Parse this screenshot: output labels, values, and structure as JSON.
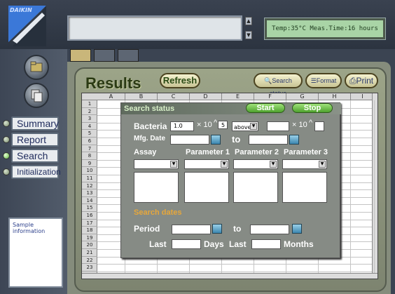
{
  "app": {
    "logo_text": "DAIKIN"
  },
  "status": {
    "lcd": "Temp:35°C  Meas.Time:16 hours"
  },
  "tabs": [
    "tab1",
    "tab2",
    "tab3"
  ],
  "nav": {
    "items": [
      "Summary",
      "Report",
      "Search",
      "Initialization"
    ],
    "selected": "Search"
  },
  "sample_panel": {
    "label": "Sample information"
  },
  "header": {
    "title": "Results",
    "refresh": "Refresh",
    "search_status": "Search status",
    "format": "Format",
    "print": "Print"
  },
  "sheet": {
    "columns": [
      "A",
      "B",
      "C",
      "D",
      "E",
      "F",
      "G",
      "H",
      "I"
    ],
    "rows": [
      "1",
      "2",
      "3",
      "4",
      "5",
      "6",
      "7",
      "8",
      "9",
      "10",
      "11",
      "12",
      "13",
      "14",
      "15",
      "16",
      "17",
      "18",
      "19",
      "20",
      "21",
      "22",
      "23"
    ]
  },
  "dialog": {
    "title": "Search status",
    "start": "Start",
    "stop": "Stop",
    "bacteria_label": "Bacteria",
    "bacteria_value": "1.0",
    "times_ten": "× 10",
    "caret": "^",
    "exponent": "5",
    "comparison": "above",
    "mfg_label": "Mfg. Date",
    "to": "to",
    "assay": "Assay",
    "param1": "Parameter 1",
    "param2": "Parameter 2",
    "param3": "Parameter 3",
    "search_dates": "Search dates",
    "period": "Period",
    "last": "Last",
    "days": "Days",
    "months": "Months"
  }
}
